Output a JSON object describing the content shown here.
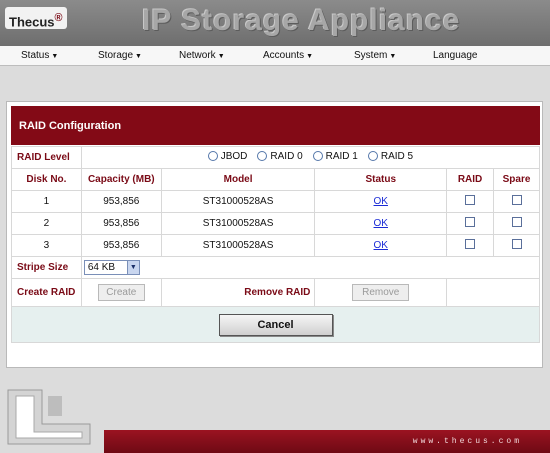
{
  "app": {
    "logo": "Thecus",
    "logo_mark": "®",
    "title": "IP Storage Appliance"
  },
  "nav": {
    "items": [
      {
        "label": "Status",
        "caret": true
      },
      {
        "label": "Storage",
        "caret": true
      },
      {
        "label": "Network",
        "caret": true
      },
      {
        "label": "Accounts",
        "caret": true
      },
      {
        "label": "System",
        "caret": true
      },
      {
        "label": "Language",
        "caret": false
      }
    ]
  },
  "panel": {
    "title": "RAID Configuration",
    "raid_level_label": "RAID Level",
    "raid_levels": [
      "JBOD",
      "RAID 0",
      "RAID 1",
      "RAID 5"
    ],
    "columns": [
      "Disk No.",
      "Capacity (MB)",
      "Model",
      "Status",
      "RAID",
      "Spare"
    ],
    "disks": [
      {
        "no": "1",
        "capacity": "953,856",
        "model": "ST31000528AS",
        "status": "OK",
        "raid": false,
        "spare": false
      },
      {
        "no": "2",
        "capacity": "953,856",
        "model": "ST31000528AS",
        "status": "OK",
        "raid": false,
        "spare": false
      },
      {
        "no": "3",
        "capacity": "953,856",
        "model": "ST31000528AS",
        "status": "OK",
        "raid": false,
        "spare": false
      }
    ],
    "stripe_label": "Stripe Size",
    "stripe_value": "64 KB",
    "create_label": "Create RAID",
    "create_button": "Create",
    "remove_label": "Remove RAID",
    "remove_button": "Remove",
    "cancel_button": "Cancel"
  },
  "footer": {
    "url": "www.thecus.com"
  },
  "colors": {
    "brand": "#830a16",
    "link": "#1a2bd6"
  }
}
